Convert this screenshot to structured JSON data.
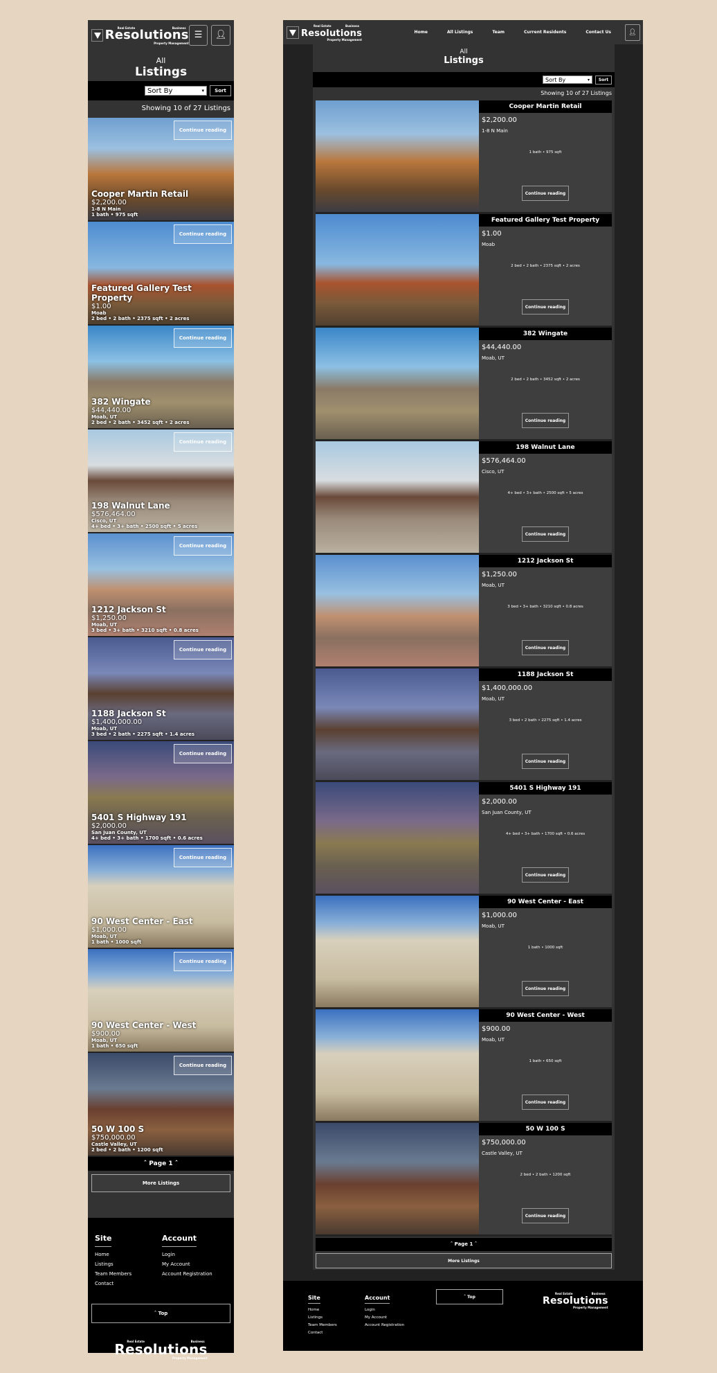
{
  "brand": {
    "main": "Resolutions",
    "top_left": "Real Estate",
    "top_right": "Business",
    "bottom": "Property Management"
  },
  "nav": [
    {
      "label": "Home"
    },
    {
      "label": "All Listings"
    },
    {
      "label": "Team"
    },
    {
      "label": "Current Residents"
    },
    {
      "label": "Contact Us"
    }
  ],
  "icons": {
    "menu": "hamburger-menu-icon",
    "user": "user-icon"
  },
  "page": {
    "title_small": "All",
    "title_big": "Listings",
    "sort_select": "Sort By",
    "sort_button": "Sort",
    "showing": "Showing 10 of 27 Listings",
    "continue": "Continue reading",
    "pagination": "ˆ Page 1 ˆ",
    "more": "More Listings"
  },
  "listings": [
    {
      "name": "Cooper Martin Retail",
      "price": "$2,200.00",
      "location": "1-8 N Main",
      "details": "1 bath • 975 sqft"
    },
    {
      "name": "Featured Gallery Test Property",
      "price": "$1.00",
      "location": "Moab",
      "details": "2 bed • 2 bath • 2375 sqft • 2 acres"
    },
    {
      "name": "382 Wingate",
      "price": "$44,440.00",
      "location": "Moab, UT",
      "details": "2 bed • 2 bath • 3452 sqft • 2 acres"
    },
    {
      "name": "198 Walnut Lane",
      "price": "$576,464.00",
      "location": "Cisco, UT",
      "details": "4+ bed • 3+ bath • 2500 sqft • 5 acres"
    },
    {
      "name": "1212 Jackson St",
      "price": "$1,250.00",
      "location": "Moab, UT",
      "details": "3 bed • 3+ bath • 3210 sqft • 0.8 acres"
    },
    {
      "name": "1188 Jackson St",
      "price": "$1,400,000.00",
      "location": "Moab, UT",
      "details": "3 bed • 2 bath • 2275 sqft • 1.4 acres"
    },
    {
      "name": "5401 S Highway 191",
      "price": "$2,000.00",
      "location": "San Juan County, UT",
      "details": "4+ bed • 3+ bath • 1700 sqft • 0.6 acres"
    },
    {
      "name": "90 West Center - East",
      "price": "$1,000.00",
      "location": "Moab, UT",
      "details": "1 bath • 1000 sqft"
    },
    {
      "name": "90 West Center - West",
      "price": "$900.00",
      "location": "Moab, UT",
      "details": "1 bath • 650 sqft"
    },
    {
      "name": "50 W 100 S",
      "price": "$750,000.00",
      "location": "Castle Valley, UT",
      "details": "2 bed • 2 bath • 1200 sqft"
    }
  ],
  "footer": {
    "site_heading": "Site",
    "site_links": [
      "Home",
      "Listings",
      "Team Members",
      "Contact"
    ],
    "account_heading": "Account",
    "account_links": [
      "Login",
      "My Account",
      "Account Registration"
    ],
    "top": "ˆ Top"
  }
}
